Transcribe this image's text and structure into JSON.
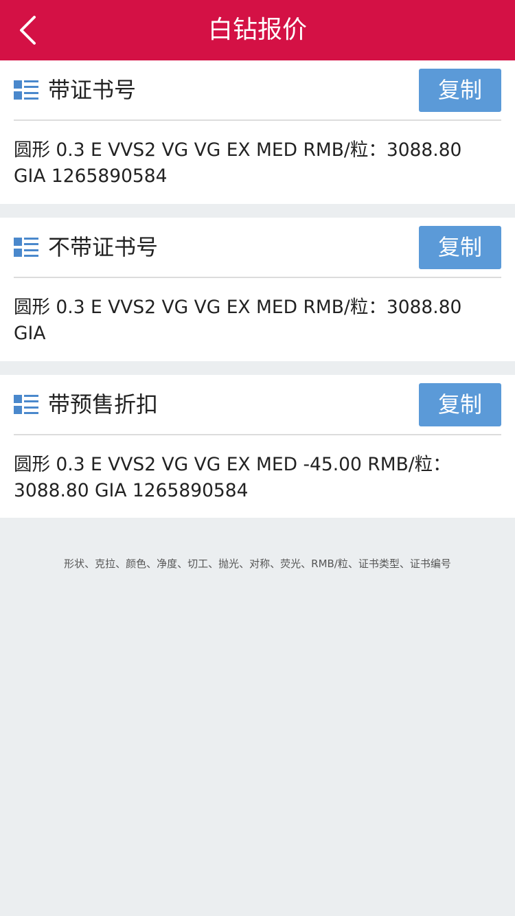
{
  "header": {
    "title": "白钻报价",
    "background": "#d41145"
  },
  "cards": [
    {
      "title": "带证书号",
      "copy_label": "复制",
      "text": "圆形 0.3 E VVS2 VG VG EX MED RMB/粒：3088.80 GIA 1265890584"
    },
    {
      "title": "不带证书号",
      "copy_label": "复制",
      "text": "圆形 0.3 E VVS2 VG VG EX MED RMB/粒：3088.80 GIA"
    },
    {
      "title": "带预售折扣",
      "copy_label": "复制",
      "text": "圆形 0.3 E VVS2 VG VG EX MED -45.00 RMB/粒：3088.80 GIA 1265890584"
    }
  ],
  "footer": {
    "note": "形状、克拉、颜色、净度、切工、抛光、对称、荧光、RMB/粒、证书类型、证书编号"
  },
  "colors": {
    "accent": "#d41145",
    "button": "#5b9ad8",
    "icon": "#4a88cc",
    "page_background": "#ebeef0"
  },
  "icons": {
    "back": "chevron-left-icon",
    "section": "list-icon"
  }
}
